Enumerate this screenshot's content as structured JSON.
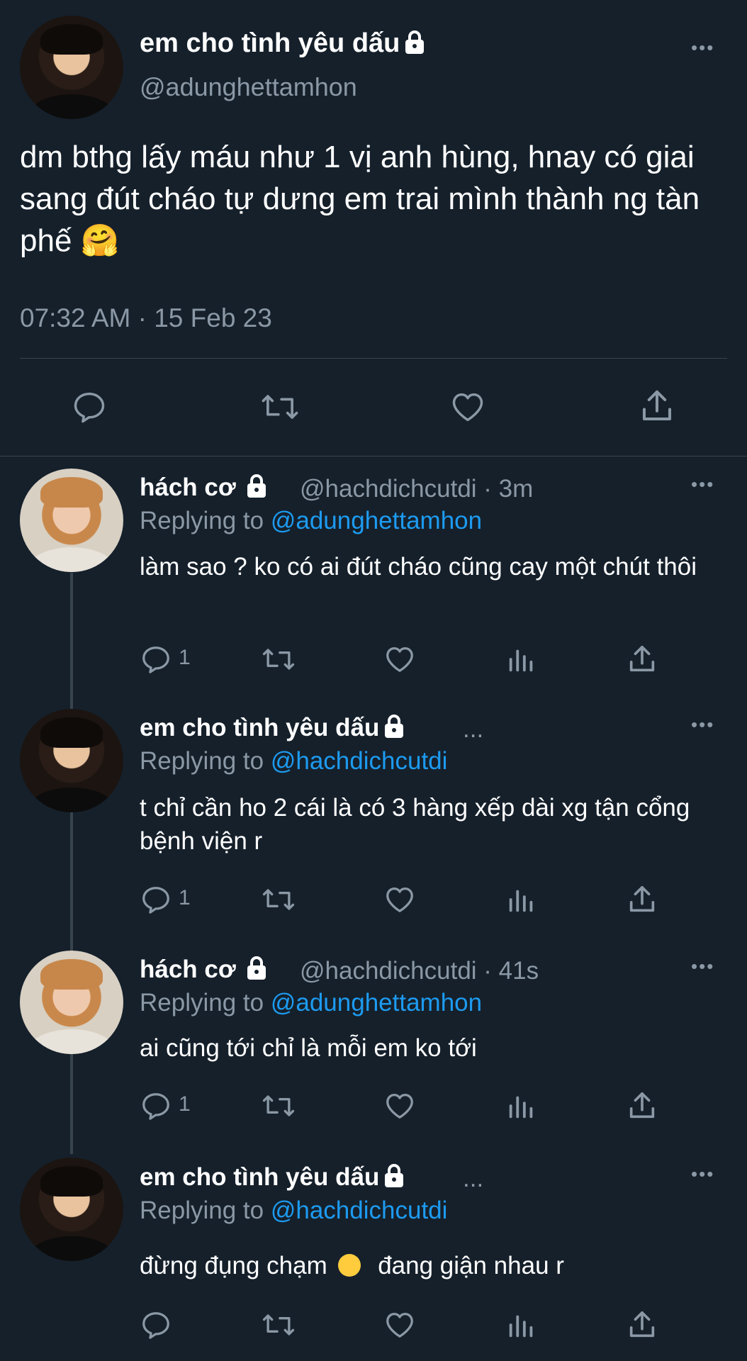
{
  "main_tweet": {
    "name": "em cho tình yêu dấu",
    "handle": "@adunghettamhon",
    "text": "dm bthg lấy máu như 1 vị anh hùng, hnay có giai sang đút cháo tự dưng em trai mình thành ng tàn phế 🤗",
    "timestamp": "07:32 AM · 15 Feb 23",
    "more_label": "•••"
  },
  "replies": [
    {
      "name": "hách cơ",
      "handle_time": "@hachdichcutdi · 3m",
      "replying_label": "Replying to",
      "replying_to": "@adunghettamhon",
      "text": "làm sao ? ko có ai đút cháo cũng cay một chút thôi",
      "reply_count": "1",
      "more_label": "•••"
    },
    {
      "name": "em cho tình yêu dấu",
      "handle_time": "...",
      "replying_label": "Replying to",
      "replying_to": "@hachdichcutdi",
      "text": "t chỉ cần ho 2 cái là có 3 hàng xếp dài xg tận cổng bệnh viện r",
      "reply_count": "1",
      "more_label": "•••"
    },
    {
      "name": "hách cơ",
      "handle_time": "@hachdichcutdi · 41s",
      "replying_label": "Replying to",
      "replying_to": "@adunghettamhon",
      "text": "ai cũng tới chỉ là mỗi em ko tới",
      "reply_count": "1",
      "more_label": "•••"
    },
    {
      "name": "em cho tình yêu dấu",
      "handle_time": "...",
      "replying_label": "Replying to",
      "replying_to": "@hachdichcutdi",
      "text_before": "đừng đụng chạm",
      "text_after": "đang giận nhau r",
      "reply_count": "",
      "more_label": "•••"
    }
  ],
  "colors": {
    "background": "#15202b",
    "muted": "#8b98a5",
    "link": "#1d9bf0",
    "divider": "#38444d"
  }
}
